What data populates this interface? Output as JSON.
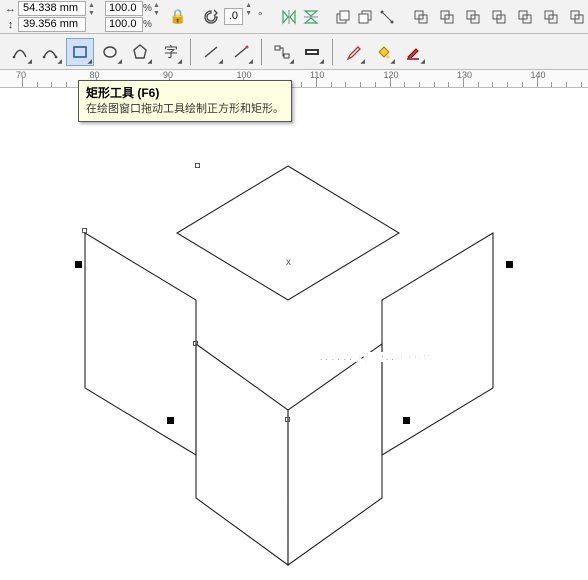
{
  "dimensions": {
    "w": "54.338 mm",
    "h": "39.356 mm",
    "scaleX": "100.0",
    "scaleY": "100.0",
    "pctUnit": "%",
    "angle": ".0",
    "angleUnit": "°"
  },
  "toolbar1": {
    "lockIcon": "lock-icon",
    "rotIcon": "rotate-cw-icon",
    "mirH": "mirror-h-icon",
    "mirV": "mirror-v-icon",
    "front": "to-front-icon",
    "back": "to-back-icon",
    "convert": "convert-icon",
    "shapeBtns": [
      "combine",
      "trim",
      "intersect",
      "simplify",
      "front-minus-back",
      "back-minus-front",
      "boundary"
    ]
  },
  "toolbar2": {
    "items": [
      {
        "name": "freehand-tool",
        "interact": true
      },
      {
        "name": "bezier-tool",
        "interact": true
      },
      {
        "name": "rectangle-tool",
        "sel": true,
        "interact": true
      },
      {
        "name": "ellipse-tool",
        "interact": true
      },
      {
        "name": "polygon-tool",
        "interact": true
      },
      {
        "name": "text-tool",
        "interact": true
      },
      {
        "name": "sep"
      },
      {
        "name": "line-1-tool",
        "interact": true
      },
      {
        "name": "line-2-tool",
        "interact": true
      },
      {
        "name": "sep"
      },
      {
        "name": "connector-tool",
        "interact": true
      },
      {
        "name": "dimension-tool",
        "interact": true
      },
      {
        "name": "sep"
      },
      {
        "name": "eyedropper-tool",
        "interact": true
      },
      {
        "name": "fill-tool",
        "interact": true
      },
      {
        "name": "outline-tool",
        "interact": true
      }
    ]
  },
  "ruler": {
    "ticks": [
      70,
      80,
      90,
      100,
      110,
      120,
      130,
      140
    ]
  },
  "tooltip": {
    "title": "矩形工具 (F6)",
    "desc": "在绘图窗口拖动工具绘制正方形和矩形。"
  },
  "watermark": "www.rjzxw.com"
}
